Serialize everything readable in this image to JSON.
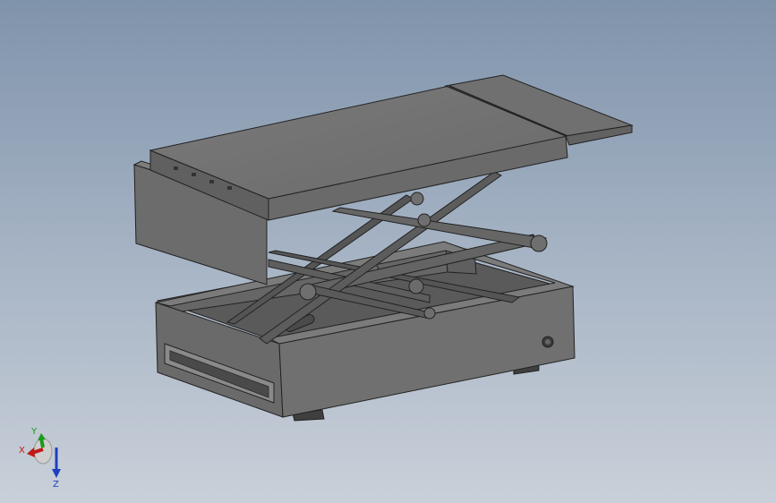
{
  "viewport": {
    "background_top": "#7f93ab",
    "background_bottom": "#c9d0d9"
  },
  "model": {
    "name": "scissor-lift-jack",
    "body_color": "#6e6e6e"
  },
  "triad": {
    "x_label": "X",
    "y_label": "Y",
    "z_label": "Z",
    "x_color": "#c01818",
    "y_color": "#1a9a1a",
    "z_color": "#1f3fbf"
  }
}
